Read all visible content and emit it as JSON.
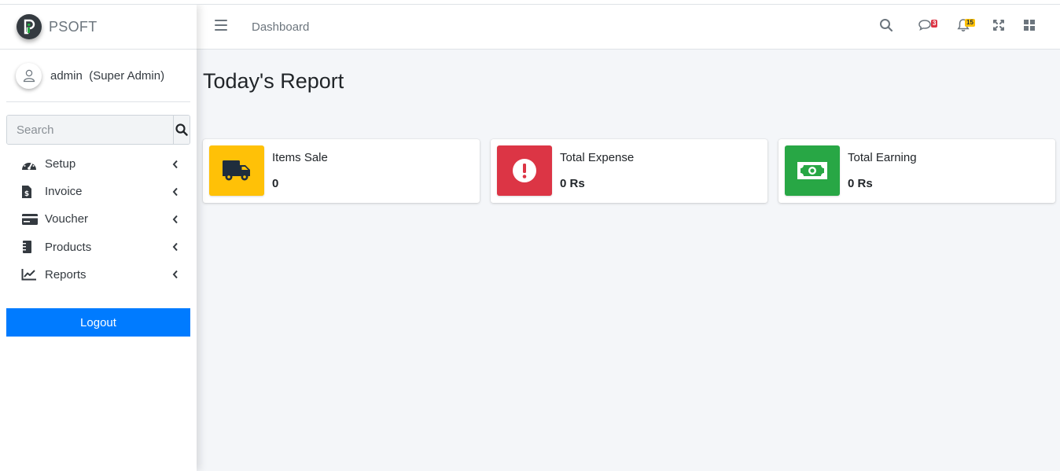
{
  "brand": {
    "name": "PSOFT"
  },
  "user": {
    "name": "admin",
    "role": "(Super Admin)"
  },
  "sidebar": {
    "search_placeholder": "Search",
    "items": [
      {
        "label": "Setup",
        "icon": "tachometer-icon"
      },
      {
        "label": "Invoice",
        "icon": "invoice-dollar-icon"
      },
      {
        "label": "Voucher",
        "icon": "credit-card-icon"
      },
      {
        "label": "Products",
        "icon": "product-list-icon"
      },
      {
        "label": "Reports",
        "icon": "line-chart-icon"
      }
    ],
    "logout_label": "Logout"
  },
  "header": {
    "title": "Dashboard",
    "messages_badge": "3",
    "notifications_badge": "15"
  },
  "content": {
    "page_title": "Today's Report",
    "cards": [
      {
        "label": "Items Sale",
        "value": "0",
        "color": "#ffc107",
        "icon": "truck-icon"
      },
      {
        "label": "Total Expense",
        "value": "0 Rs",
        "color": "#dc3545",
        "icon": "exclamation-circle-icon"
      },
      {
        "label": "Total Earning",
        "value": "0 Rs",
        "color": "#28a745",
        "icon": "money-bill-icon"
      }
    ]
  },
  "colors": {
    "primary": "#007bff",
    "warning": "#ffc107",
    "danger": "#dc3545",
    "success": "#28a745"
  }
}
